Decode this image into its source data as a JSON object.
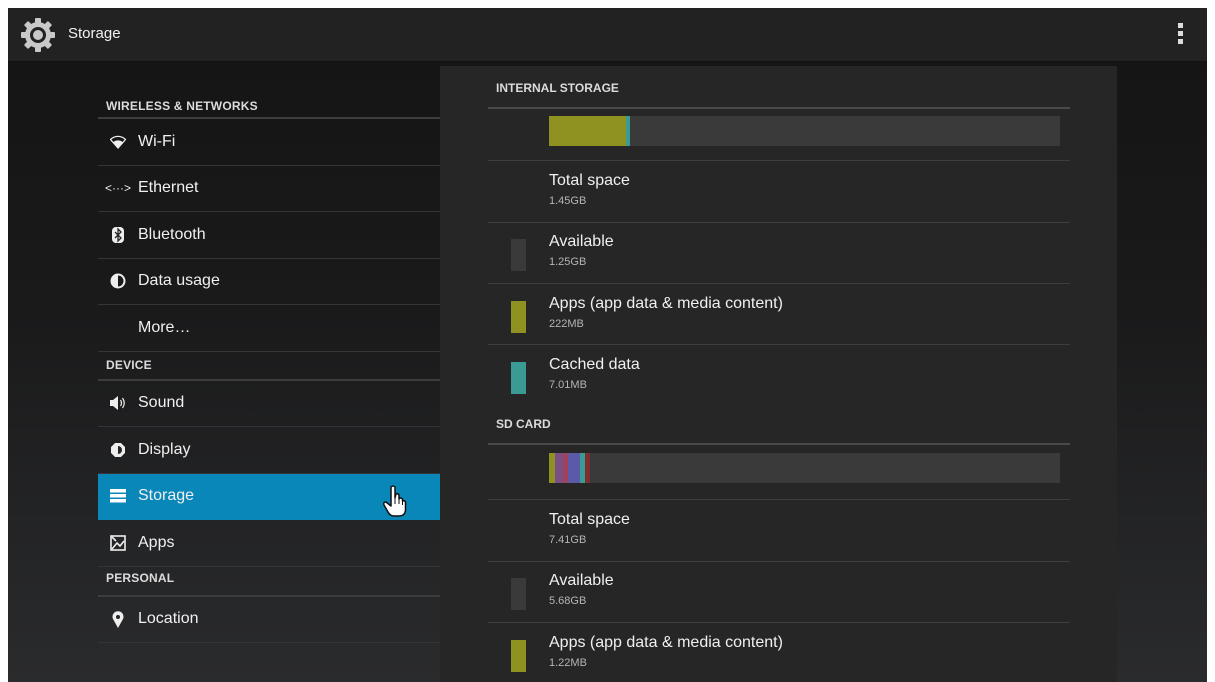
{
  "colors": {
    "accent_selected": "#0a87b9",
    "apps": "#8f9120",
    "cached": "#3a9a94",
    "available": "#3a3a3a"
  },
  "action_bar": {
    "title": "Storage",
    "app_icon": "settings-gear-icon",
    "overflow_icon": "overflow-menu-icon"
  },
  "sidebar": {
    "sections": [
      {
        "header": "WIRELESS & NETWORKS",
        "items": [
          {
            "label": "Wi-Fi",
            "icon": "wifi-icon"
          },
          {
            "label": "Ethernet",
            "icon": "ethernet-icon"
          },
          {
            "label": "Bluetooth",
            "icon": "bluetooth-icon"
          },
          {
            "label": "Data usage",
            "icon": "data-usage-icon"
          },
          {
            "label": "More…",
            "icon": ""
          }
        ]
      },
      {
        "header": "DEVICE",
        "items": [
          {
            "label": "Sound",
            "icon": "speaker-icon"
          },
          {
            "label": "Display",
            "icon": "brightness-icon"
          },
          {
            "label": "Storage",
            "icon": "storage-icon",
            "selected": true
          },
          {
            "label": "Apps",
            "icon": "apps-icon"
          }
        ]
      },
      {
        "header": "PERSONAL",
        "items": [
          {
            "label": "Location",
            "icon": "location-pin-icon"
          }
        ]
      }
    ]
  },
  "internal_storage": {
    "header": "INTERNAL STORAGE",
    "usage_fractions": {
      "apps": 0.15,
      "cached": 0.008
    },
    "rows": [
      {
        "label": "Total space",
        "value": "1.45GB"
      },
      {
        "label": "Available",
        "value": "1.25GB"
      },
      {
        "label": "Apps (app data & media content)",
        "value": "222MB"
      },
      {
        "label": "Cached data",
        "value": "7.01MB"
      }
    ]
  },
  "sd_card": {
    "header": "SD CARD",
    "usage_segments": [
      {
        "color": "#8f9120",
        "fraction": 0.012
      },
      {
        "color": "#7a4e86",
        "fraction": 0.016
      },
      {
        "color": "#a0435a",
        "fraction": 0.01
      },
      {
        "color": "#5a5aa8",
        "fraction": 0.022
      },
      {
        "color": "#3a9a94",
        "fraction": 0.01
      },
      {
        "color": "#7c3030",
        "fraction": 0.01
      }
    ],
    "rows": [
      {
        "label": "Total space",
        "value": "7.41GB"
      },
      {
        "label": "Available",
        "value": "5.68GB"
      },
      {
        "label": "Apps (app data & media content)",
        "value": "1.22MB"
      }
    ]
  }
}
